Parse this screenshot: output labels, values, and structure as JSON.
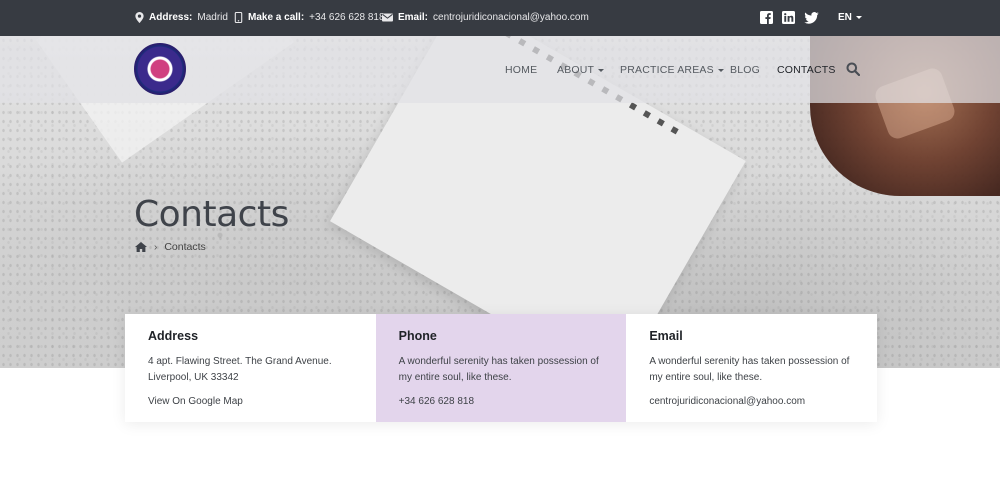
{
  "topbar": {
    "address_label": "Address:",
    "address_value": "Madrid",
    "call_label": "Make a call:",
    "call_value": "+34 626 628 818",
    "email_label": "Email:",
    "email_value": "centrojuridiconacional@yahoo.com",
    "language": "EN",
    "social": [
      "facebook-icon",
      "linkedin-icon",
      "twitter-icon"
    ]
  },
  "nav": {
    "items": [
      {
        "label": "HOME",
        "dropdown": false
      },
      {
        "label": "ABOUT",
        "dropdown": true
      },
      {
        "label": "PRACTICE AREAS",
        "dropdown": true
      },
      {
        "label": "BLOG",
        "dropdown": false
      },
      {
        "label": "CONTACTS",
        "dropdown": false,
        "active": true
      }
    ]
  },
  "hero": {
    "title": "Contacts",
    "breadcrumb_current": "Contacts"
  },
  "cards": [
    {
      "title": "Address",
      "text": "4 apt. Flawing Street. The Grand Avenue. Liverpool, UK 33342",
      "link": "View On Google Map"
    },
    {
      "title": "Phone",
      "text": "A wonderful serenity has taken possession of my entire soul, like these.",
      "link": "+34 626 628 818"
    },
    {
      "title": "Email",
      "text": "A wonderful serenity has taken possession of my entire soul, like these.",
      "link": "centrojuridiconacional@yahoo.com"
    }
  ],
  "colors": {
    "topbar_bg": "#373b42",
    "accent_card": "#e3d5ec"
  }
}
